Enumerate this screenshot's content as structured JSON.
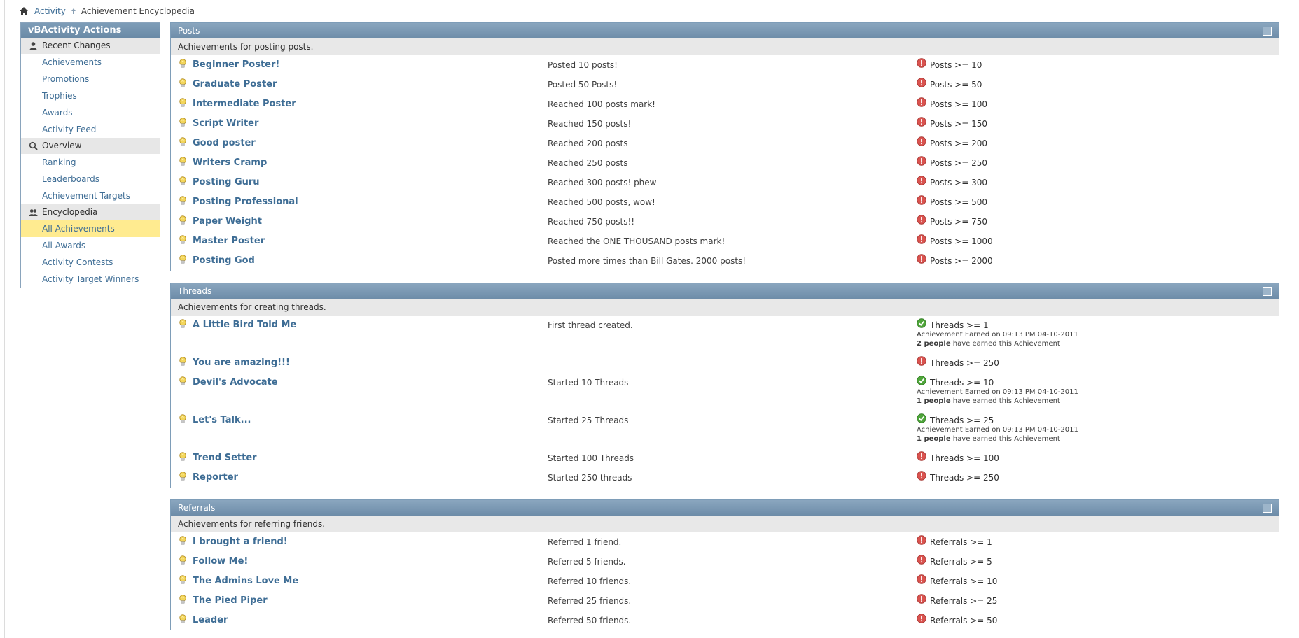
{
  "breadcrumb": {
    "activity": "Activity",
    "current": "Achievement Encyclopedia"
  },
  "sidebar": {
    "title": "vBActivity Actions",
    "sections": [
      {
        "label": "Recent Changes",
        "icon": "person-icon",
        "items": [
          "Achievements",
          "Promotions",
          "Trophies",
          "Awards",
          "Activity Feed"
        ]
      },
      {
        "label": "Overview",
        "icon": "magnifier-icon",
        "items": [
          "Ranking",
          "Leaderboards",
          "Achievement Targets"
        ]
      },
      {
        "label": "Encyclopedia",
        "icon": "people-icon",
        "items": [
          "All Achievements",
          "All Awards",
          "Activity Contests",
          "Activity Target Winners"
        ]
      }
    ],
    "active_item": "All Achievements"
  },
  "panels": {
    "posts": {
      "title": "Posts",
      "description": "Achievements for posting posts.",
      "rows": [
        {
          "title": "Beginner Poster!",
          "desc": "Posted 10 posts!",
          "crit": "Posts >= 10"
        },
        {
          "title": "Graduate Poster",
          "desc": "Posted 50 Posts!",
          "crit": "Posts >= 50"
        },
        {
          "title": "Intermediate Poster",
          "desc": "Reached 100 posts mark!",
          "crit": "Posts >= 100"
        },
        {
          "title": "Script Writer",
          "desc": "Reached 150 posts!",
          "crit": "Posts >= 150"
        },
        {
          "title": "Good poster",
          "desc": "Reached 200 posts",
          "crit": "Posts >= 200"
        },
        {
          "title": "Writers Cramp",
          "desc": "Reached 250 posts",
          "crit": "Posts >= 250"
        },
        {
          "title": "Posting Guru",
          "desc": "Reached 300 posts! phew",
          "crit": "Posts >= 300"
        },
        {
          "title": "Posting Professional",
          "desc": "Reached 500 posts, wow!",
          "crit": "Posts >= 500"
        },
        {
          "title": "Paper Weight",
          "desc": "Reached 750 posts!!",
          "crit": "Posts >= 750"
        },
        {
          "title": "Master Poster",
          "desc": "Reached the ONE THOUSAND posts mark!",
          "crit": "Posts >= 1000"
        },
        {
          "title": "Posting God",
          "desc": "Posted more times than Bill Gates. 2000 posts!",
          "crit": "Posts >= 2000"
        }
      ]
    },
    "threads": {
      "title": "Threads",
      "description": "Achievements for creating threads.",
      "rows": [
        {
          "title": "A Little Bird Told Me",
          "desc": "First thread created.",
          "crit": "Threads >= 1",
          "earned": "Achievement Earned on 09:13 PM 04-10-2011",
          "people_bold": "2 people",
          "people_rest": " have earned this Achievement"
        },
        {
          "title": "You are amazing!!!",
          "desc": "",
          "crit": "Threads >= 250"
        },
        {
          "title": "Devil's Advocate",
          "desc": "Started 10 Threads",
          "crit": "Threads >= 10",
          "earned": "Achievement Earned on 09:13 PM 04-10-2011",
          "people_bold": "1 people",
          "people_rest": " have earned this Achievement"
        },
        {
          "title": "Let's Talk...",
          "desc": "Started 25 Threads",
          "crit": "Threads >= 25",
          "earned": "Achievement Earned on 09:13 PM 04-10-2011",
          "people_bold": "1 people",
          "people_rest": " have earned this Achievement"
        },
        {
          "title": "Trend Setter",
          "desc": "Started 100 Threads",
          "crit": "Threads >= 100"
        },
        {
          "title": "Reporter",
          "desc": "Started 250 threads",
          "crit": "Threads >= 250"
        }
      ]
    },
    "referrals": {
      "title": "Referrals",
      "description": "Achievements for referring friends.",
      "rows": [
        {
          "title": "I brought a friend!",
          "desc": "Referred 1 friend.",
          "crit": "Referrals >= 1"
        },
        {
          "title": "Follow Me!",
          "desc": "Referred 5 friends.",
          "crit": "Referrals >= 5"
        },
        {
          "title": "The Admins Love Me",
          "desc": "Referred 10 friends.",
          "crit": "Referrals >= 10"
        },
        {
          "title": "The Pied Piper",
          "desc": "Referred 25 friends.",
          "crit": "Referrals >= 25"
        },
        {
          "title": "Leader",
          "desc": "Referred 50 friends.",
          "crit": "Referrals >= 50"
        }
      ]
    }
  },
  "colors": {
    "link": "#3e6d95",
    "header": "#7e9db8",
    "highlight": "#ffeb90",
    "status_red": "#d9534f",
    "status_green": "#4fa53a"
  }
}
